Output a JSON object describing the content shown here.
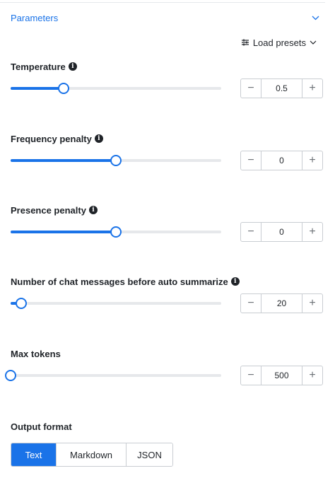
{
  "section": {
    "title": "Parameters",
    "presets_label": "Load presets"
  },
  "colors": {
    "accent": "#1a73e8",
    "track": "#e6e8eb",
    "border": "#c9cdd2"
  },
  "params": [
    {
      "label": "Temperature",
      "has_info": true,
      "value": "0.5",
      "fraction": 0.25
    },
    {
      "label": "Frequency penalty",
      "has_info": true,
      "value": "0",
      "fraction": 0.5
    },
    {
      "label": "Presence penalty",
      "has_info": true,
      "value": "0",
      "fraction": 0.5
    },
    {
      "label": "Number of chat messages before auto summarize",
      "has_info": true,
      "value": "20",
      "fraction": 0.05
    },
    {
      "label": "Max tokens",
      "has_info": false,
      "value": "500",
      "fraction": 0.0
    }
  ],
  "output_format": {
    "label": "Output format",
    "options": [
      "Text",
      "Markdown",
      "JSON"
    ],
    "selected": "Text"
  }
}
